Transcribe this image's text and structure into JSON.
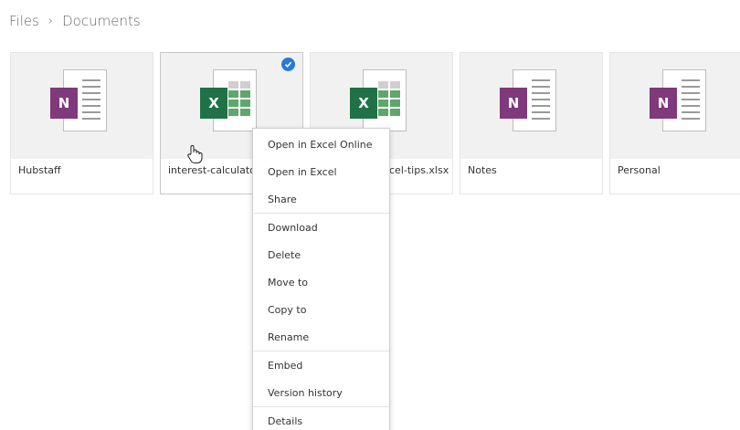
{
  "breadcrumb": {
    "items": [
      "Files",
      "Documents"
    ],
    "separator": "›"
  },
  "files": [
    {
      "name": "Hubstaff",
      "type": "onenote",
      "badge": "N",
      "selected": false
    },
    {
      "name": "interest-calculato",
      "type": "excel",
      "badge": "X",
      "selected": true
    },
    {
      "name": "cel-tips.xlsx",
      "type": "excel",
      "badge": "X",
      "selected": false
    },
    {
      "name": "Notes",
      "type": "onenote",
      "badge": "N",
      "selected": false
    },
    {
      "name": "Personal",
      "type": "onenote",
      "badge": "N",
      "selected": false
    }
  ],
  "context_menu": {
    "items": [
      "Open in Excel Online",
      "Open in Excel",
      "Share",
      "Download",
      "Delete",
      "Move to",
      "Copy to",
      "Rename",
      "Embed",
      "Version history",
      "Details"
    ]
  },
  "colors": {
    "onenote": "#80397b",
    "excel": "#1f7246",
    "accent": "#2b78d6"
  },
  "icons": {
    "cursor": "hand-pointer-icon",
    "check": "checkmark-icon"
  }
}
